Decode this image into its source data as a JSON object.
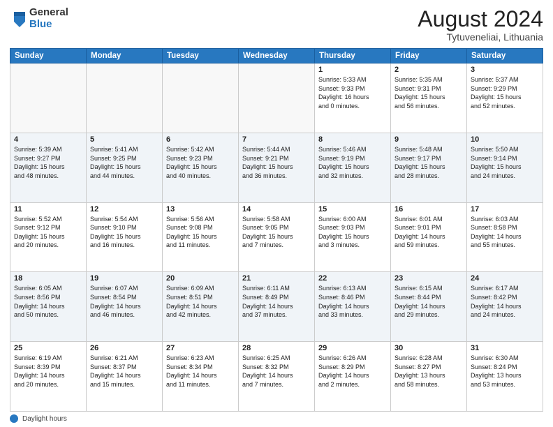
{
  "logo": {
    "general": "General",
    "blue": "Blue"
  },
  "title": "August 2024",
  "subtitle": "Tytuveneliai, Lithuania",
  "weekdays": [
    "Sunday",
    "Monday",
    "Tuesday",
    "Wednesday",
    "Thursday",
    "Friday",
    "Saturday"
  ],
  "footer_label": "Daylight hours",
  "weeks": [
    [
      {
        "day": "",
        "info": ""
      },
      {
        "day": "",
        "info": ""
      },
      {
        "day": "",
        "info": ""
      },
      {
        "day": "",
        "info": ""
      },
      {
        "day": "1",
        "info": "Sunrise: 5:33 AM\nSunset: 9:33 PM\nDaylight: 16 hours\nand 0 minutes."
      },
      {
        "day": "2",
        "info": "Sunrise: 5:35 AM\nSunset: 9:31 PM\nDaylight: 15 hours\nand 56 minutes."
      },
      {
        "day": "3",
        "info": "Sunrise: 5:37 AM\nSunset: 9:29 PM\nDaylight: 15 hours\nand 52 minutes."
      }
    ],
    [
      {
        "day": "4",
        "info": "Sunrise: 5:39 AM\nSunset: 9:27 PM\nDaylight: 15 hours\nand 48 minutes."
      },
      {
        "day": "5",
        "info": "Sunrise: 5:41 AM\nSunset: 9:25 PM\nDaylight: 15 hours\nand 44 minutes."
      },
      {
        "day": "6",
        "info": "Sunrise: 5:42 AM\nSunset: 9:23 PM\nDaylight: 15 hours\nand 40 minutes."
      },
      {
        "day": "7",
        "info": "Sunrise: 5:44 AM\nSunset: 9:21 PM\nDaylight: 15 hours\nand 36 minutes."
      },
      {
        "day": "8",
        "info": "Sunrise: 5:46 AM\nSunset: 9:19 PM\nDaylight: 15 hours\nand 32 minutes."
      },
      {
        "day": "9",
        "info": "Sunrise: 5:48 AM\nSunset: 9:17 PM\nDaylight: 15 hours\nand 28 minutes."
      },
      {
        "day": "10",
        "info": "Sunrise: 5:50 AM\nSunset: 9:14 PM\nDaylight: 15 hours\nand 24 minutes."
      }
    ],
    [
      {
        "day": "11",
        "info": "Sunrise: 5:52 AM\nSunset: 9:12 PM\nDaylight: 15 hours\nand 20 minutes."
      },
      {
        "day": "12",
        "info": "Sunrise: 5:54 AM\nSunset: 9:10 PM\nDaylight: 15 hours\nand 16 minutes."
      },
      {
        "day": "13",
        "info": "Sunrise: 5:56 AM\nSunset: 9:08 PM\nDaylight: 15 hours\nand 11 minutes."
      },
      {
        "day": "14",
        "info": "Sunrise: 5:58 AM\nSunset: 9:05 PM\nDaylight: 15 hours\nand 7 minutes."
      },
      {
        "day": "15",
        "info": "Sunrise: 6:00 AM\nSunset: 9:03 PM\nDaylight: 15 hours\nand 3 minutes."
      },
      {
        "day": "16",
        "info": "Sunrise: 6:01 AM\nSunset: 9:01 PM\nDaylight: 14 hours\nand 59 minutes."
      },
      {
        "day": "17",
        "info": "Sunrise: 6:03 AM\nSunset: 8:58 PM\nDaylight: 14 hours\nand 55 minutes."
      }
    ],
    [
      {
        "day": "18",
        "info": "Sunrise: 6:05 AM\nSunset: 8:56 PM\nDaylight: 14 hours\nand 50 minutes."
      },
      {
        "day": "19",
        "info": "Sunrise: 6:07 AM\nSunset: 8:54 PM\nDaylight: 14 hours\nand 46 minutes."
      },
      {
        "day": "20",
        "info": "Sunrise: 6:09 AM\nSunset: 8:51 PM\nDaylight: 14 hours\nand 42 minutes."
      },
      {
        "day": "21",
        "info": "Sunrise: 6:11 AM\nSunset: 8:49 PM\nDaylight: 14 hours\nand 37 minutes."
      },
      {
        "day": "22",
        "info": "Sunrise: 6:13 AM\nSunset: 8:46 PM\nDaylight: 14 hours\nand 33 minutes."
      },
      {
        "day": "23",
        "info": "Sunrise: 6:15 AM\nSunset: 8:44 PM\nDaylight: 14 hours\nand 29 minutes."
      },
      {
        "day": "24",
        "info": "Sunrise: 6:17 AM\nSunset: 8:42 PM\nDaylight: 14 hours\nand 24 minutes."
      }
    ],
    [
      {
        "day": "25",
        "info": "Sunrise: 6:19 AM\nSunset: 8:39 PM\nDaylight: 14 hours\nand 20 minutes."
      },
      {
        "day": "26",
        "info": "Sunrise: 6:21 AM\nSunset: 8:37 PM\nDaylight: 14 hours\nand 15 minutes."
      },
      {
        "day": "27",
        "info": "Sunrise: 6:23 AM\nSunset: 8:34 PM\nDaylight: 14 hours\nand 11 minutes."
      },
      {
        "day": "28",
        "info": "Sunrise: 6:25 AM\nSunset: 8:32 PM\nDaylight: 14 hours\nand 7 minutes."
      },
      {
        "day": "29",
        "info": "Sunrise: 6:26 AM\nSunset: 8:29 PM\nDaylight: 14 hours\nand 2 minutes."
      },
      {
        "day": "30",
        "info": "Sunrise: 6:28 AM\nSunset: 8:27 PM\nDaylight: 13 hours\nand 58 minutes."
      },
      {
        "day": "31",
        "info": "Sunrise: 6:30 AM\nSunset: 8:24 PM\nDaylight: 13 hours\nand 53 minutes."
      }
    ]
  ]
}
